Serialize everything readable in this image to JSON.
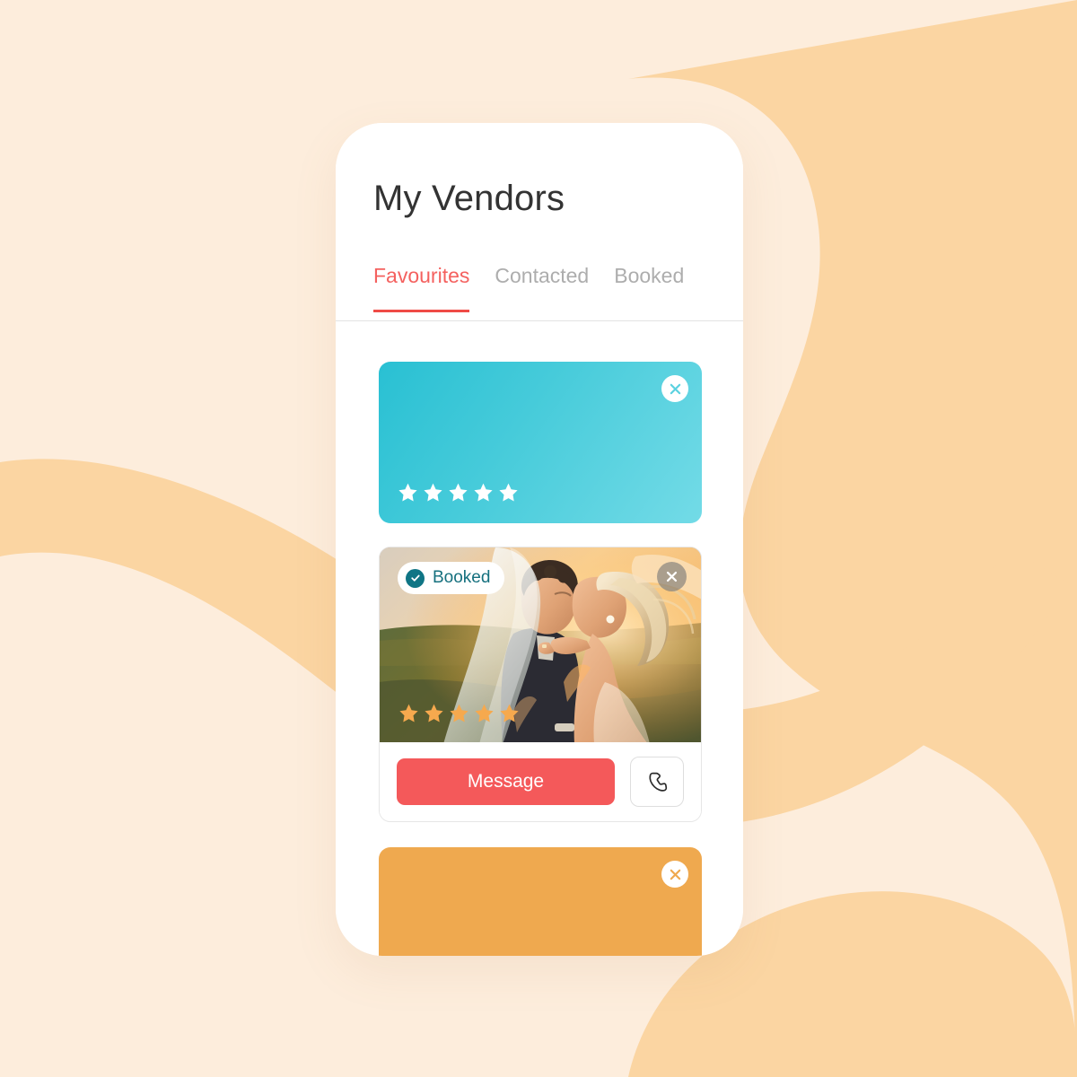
{
  "background": {
    "base_color": "#fdeddc",
    "blob_color": "#fbd5a2",
    "shape_name": "organic-ribbon-blob"
  },
  "phone": {
    "frame_color": "#ffffff",
    "screen_color": "#ffffff"
  },
  "header": {
    "title": "My Vendors",
    "title_color": "#333333"
  },
  "tabs": {
    "active_color": "#f4615f",
    "inactive_color": "#adadad",
    "indicator_color": "#ef4b46",
    "items": [
      {
        "label": "Favourites",
        "active": true
      },
      {
        "label": "Contacted",
        "active": false
      },
      {
        "label": "Booked",
        "active": false
      }
    ]
  },
  "cards": [
    {
      "id": "card-teal",
      "kind": "placeholder",
      "background_from": "#29c0d3",
      "background_to": "#73dbe7",
      "rating": 5,
      "star_color": "#ffffff",
      "close": {
        "icon": "close-icon",
        "glyph_color": "#5cd2e0",
        "bg_color": "#ffffff"
      }
    },
    {
      "id": "card-photo",
      "kind": "vendor",
      "photo_alt": "wedding couple kissing at sunset",
      "badge": {
        "label": "Booked",
        "icon": "check-circle-icon",
        "color": "#15707e",
        "bg_color": "#ffffff"
      },
      "rating": 5,
      "star_color": "#f6a94e",
      "close": {
        "icon": "close-icon",
        "glyph_color": "#ffffff",
        "bg_color": "rgba(120,120,120,0.62)"
      },
      "actions": {
        "message_label": "Message",
        "message_color": "#f4595a",
        "call_icon": "phone-icon",
        "call_icon_color": "#2b2b2b"
      }
    },
    {
      "id": "card-orange",
      "kind": "placeholder",
      "background_color": "#efa94f",
      "close": {
        "icon": "close-icon",
        "glyph_color": "#efa94f",
        "bg_color": "#ffffff"
      }
    }
  ]
}
